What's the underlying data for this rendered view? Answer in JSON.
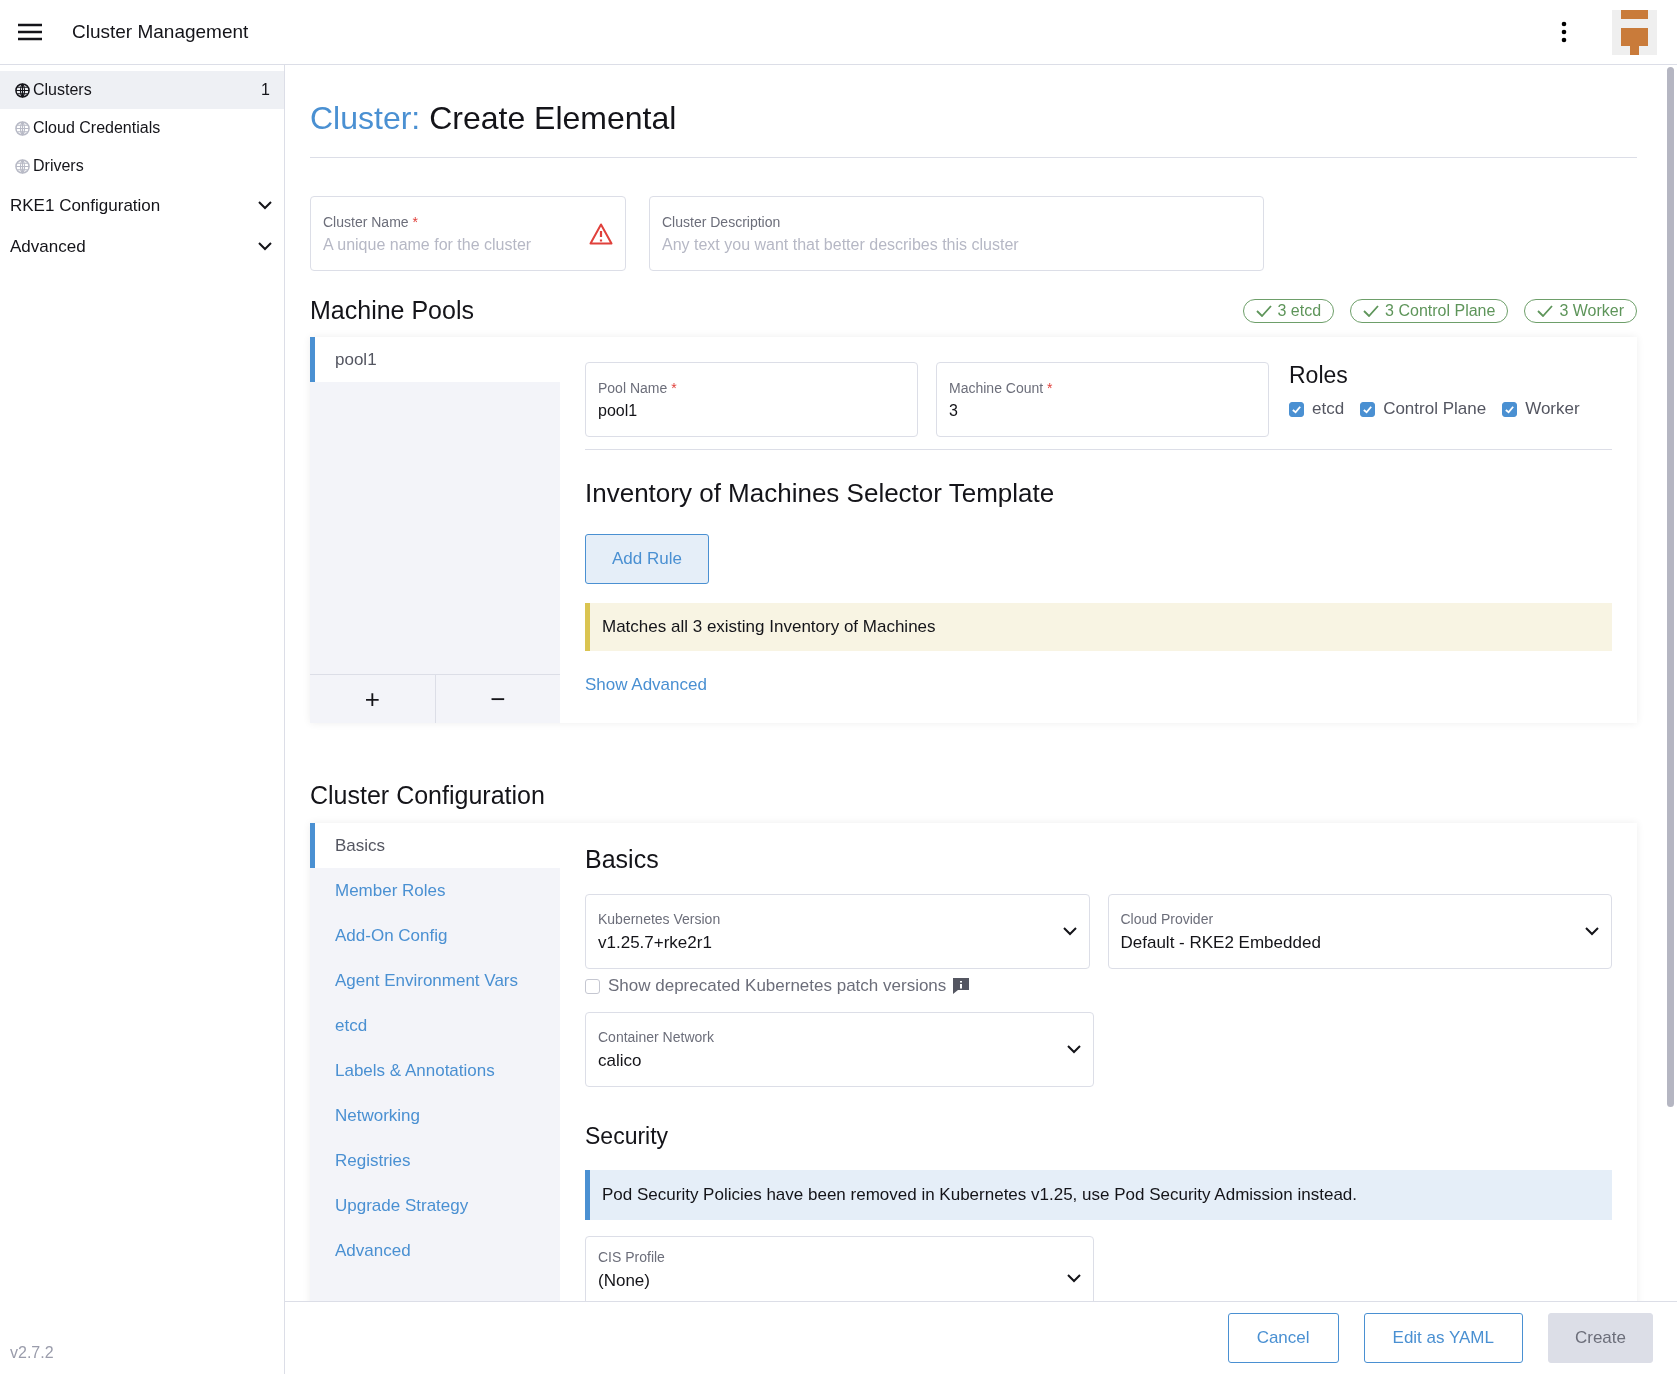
{
  "header": {
    "title": "Cluster Management"
  },
  "sidebar": {
    "items": [
      {
        "label": "Clusters",
        "count": "1",
        "selected": true
      },
      {
        "label": "Cloud Credentials",
        "selected": false
      },
      {
        "label": "Drivers",
        "selected": false
      }
    ],
    "groups": [
      {
        "label": "RKE1 Configuration",
        "expanded": false
      },
      {
        "label": "Advanced",
        "expanded": false
      }
    ],
    "version": "v2.7.2"
  },
  "page": {
    "title_prefix": "Cluster:",
    "title": "Create Elemental"
  },
  "cluster_fields": [
    {
      "label": "Cluster Name",
      "mark": "*",
      "placeholder": "A unique name for the cluster",
      "error": true
    },
    {
      "label": "Cluster Description",
      "placeholder": "Any text you want that better describes this cluster",
      "error": false
    }
  ],
  "machine_pools": {
    "heading": "Machine Pools",
    "badges": [
      "3 etcd",
      "3 Control Plane",
      "3 Worker"
    ],
    "pools": [
      {
        "name": "pool1",
        "selected": true
      }
    ],
    "add": "+",
    "remove": "−",
    "fields": [
      {
        "label": "Pool Name",
        "mark": "*",
        "value": "pool1"
      },
      {
        "label": "Machine Count",
        "mark": "*",
        "value": "3"
      }
    ],
    "roles": {
      "heading": "Roles",
      "items": [
        {
          "label": "etcd",
          "checked": true
        },
        {
          "label": "Control Plane",
          "checked": true
        },
        {
          "label": "Worker",
          "checked": true
        }
      ]
    },
    "selector_heading": "Inventory of Machines Selector Template",
    "add_rule": "Add Rule",
    "banner": {
      "kind": "warning",
      "text": "Matches all 3 existing Inventory of Machines"
    },
    "show_advanced": "Show Advanced"
  },
  "cluster_config": {
    "heading": "Cluster Configuration",
    "tabs": [
      {
        "label": "Basics",
        "selected": true
      },
      {
        "label": "Member Roles",
        "selected": false
      },
      {
        "label": "Add-On Config",
        "selected": false
      },
      {
        "label": "Agent Environment Vars",
        "selected": false
      },
      {
        "label": "etcd",
        "selected": false
      },
      {
        "label": "Labels & Annotations",
        "selected": false
      },
      {
        "label": "Networking",
        "selected": false
      },
      {
        "label": "Registries",
        "selected": false
      },
      {
        "label": "Upgrade Strategy",
        "selected": false
      },
      {
        "label": "Advanced",
        "selected": false
      }
    ],
    "section": "Basics",
    "selects": [
      {
        "label": "Kubernetes Version",
        "value": "v1.25.7+rke2r1"
      },
      {
        "label": "Cloud Provider",
        "value": "Default - RKE2 Embedded"
      }
    ],
    "deprecated": {
      "label": "Show deprecated Kubernetes patch versions",
      "checked": false
    },
    "container_network": {
      "label": "Container Network",
      "value": "calico"
    },
    "security": {
      "heading": "Security",
      "banner": {
        "kind": "info",
        "text": "Pod Security Policies have been removed in Kubernetes v1.25, use Pod Security Admission instead."
      },
      "cis": {
        "label": "CIS Profile",
        "value": "(None)"
      }
    }
  },
  "footer": {
    "buttons": [
      {
        "label": "Cancel",
        "kind": "secondary"
      },
      {
        "label": "Edit as YAML",
        "kind": "secondary"
      },
      {
        "label": "Create",
        "kind": "disabled"
      }
    ]
  }
}
